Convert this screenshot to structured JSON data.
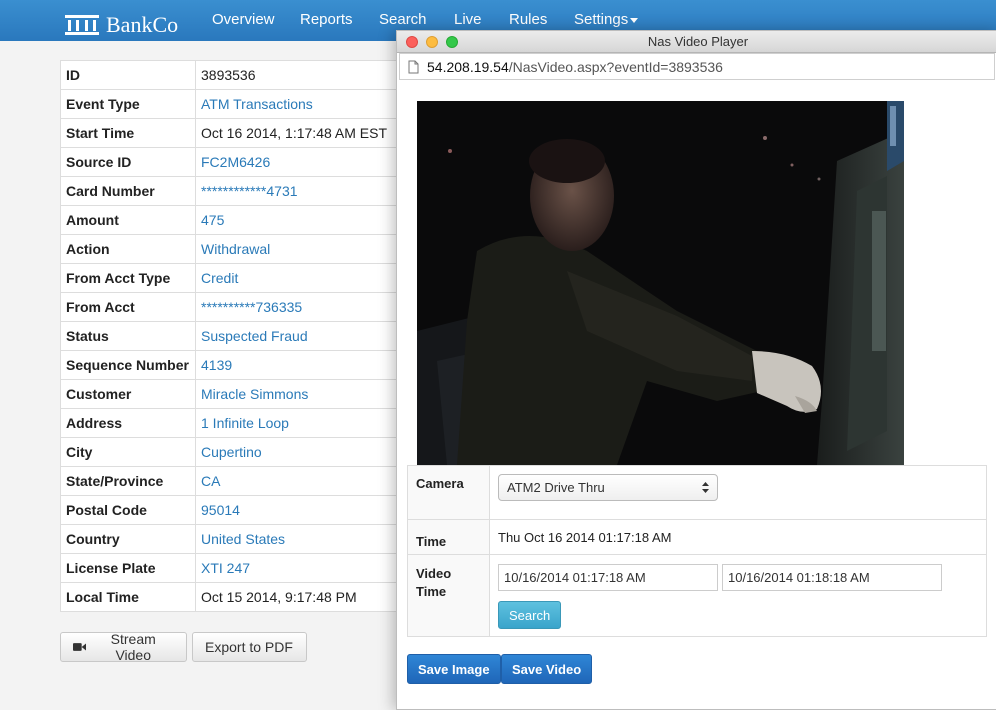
{
  "navbar": {
    "brand": "BankCo",
    "items": [
      "Overview",
      "Reports",
      "Search",
      "Live",
      "Rules",
      "Settings"
    ]
  },
  "details": {
    "rows": [
      {
        "label": "ID",
        "value": "3893536"
      },
      {
        "label": "Event Type",
        "value": "ATM Transactions"
      },
      {
        "label": "Start Time",
        "value": "Oct 16 2014, 1:17:48 AM EST"
      },
      {
        "label": "Source ID",
        "value": "FC2M6426"
      },
      {
        "label": "Card Number",
        "value": "************4731"
      },
      {
        "label": "Amount",
        "value": "475"
      },
      {
        "label": "Action",
        "value": "Withdrawal"
      },
      {
        "label": "From Acct Type",
        "value": "Credit"
      },
      {
        "label": "From Acct",
        "value": "**********736335"
      },
      {
        "label": "Status",
        "value": "Suspected Fraud"
      },
      {
        "label": "Sequence Number",
        "value": "4139"
      },
      {
        "label": "Customer",
        "value": "Miracle Simmons"
      },
      {
        "label": "Address",
        "value": "1 Infinite Loop"
      },
      {
        "label": "City",
        "value": "Cupertino"
      },
      {
        "label": "State/Province",
        "value": "CA"
      },
      {
        "label": "Postal Code",
        "value": "95014"
      },
      {
        "label": "Country",
        "value": "United States"
      },
      {
        "label": "License Plate",
        "value": "XTI 247"
      },
      {
        "label": "Local Time",
        "value": "Oct 15 2014, 9:17:48 PM"
      }
    ],
    "stream_label": "Stream Video",
    "export_label": "Export to PDF"
  },
  "player": {
    "window_title": "Nas Video Player",
    "url_host": "54.208.19.54",
    "url_path": "/NasVideo.aspx?eventId=3893536",
    "camera_label": "Camera",
    "camera_value": "ATM2 Drive Thru",
    "time_label": "Time",
    "time_value": "Thu Oct 16 2014 01:17:18 AM",
    "video_time_label_1": "Video",
    "video_time_label_2": "Time",
    "start_value": "10/16/2014 01:17:18 AM",
    "end_value": "10/16/2014 01:18:18 AM",
    "search_label": "Search",
    "save_image_label": "Save Image",
    "save_video_label": "Save Video"
  },
  "colors": {
    "navbar": "#2f82c6",
    "link": "#2a7ab8",
    "close": "#fc605c",
    "minimize": "#fdbc40",
    "zoom": "#34c84a"
  }
}
